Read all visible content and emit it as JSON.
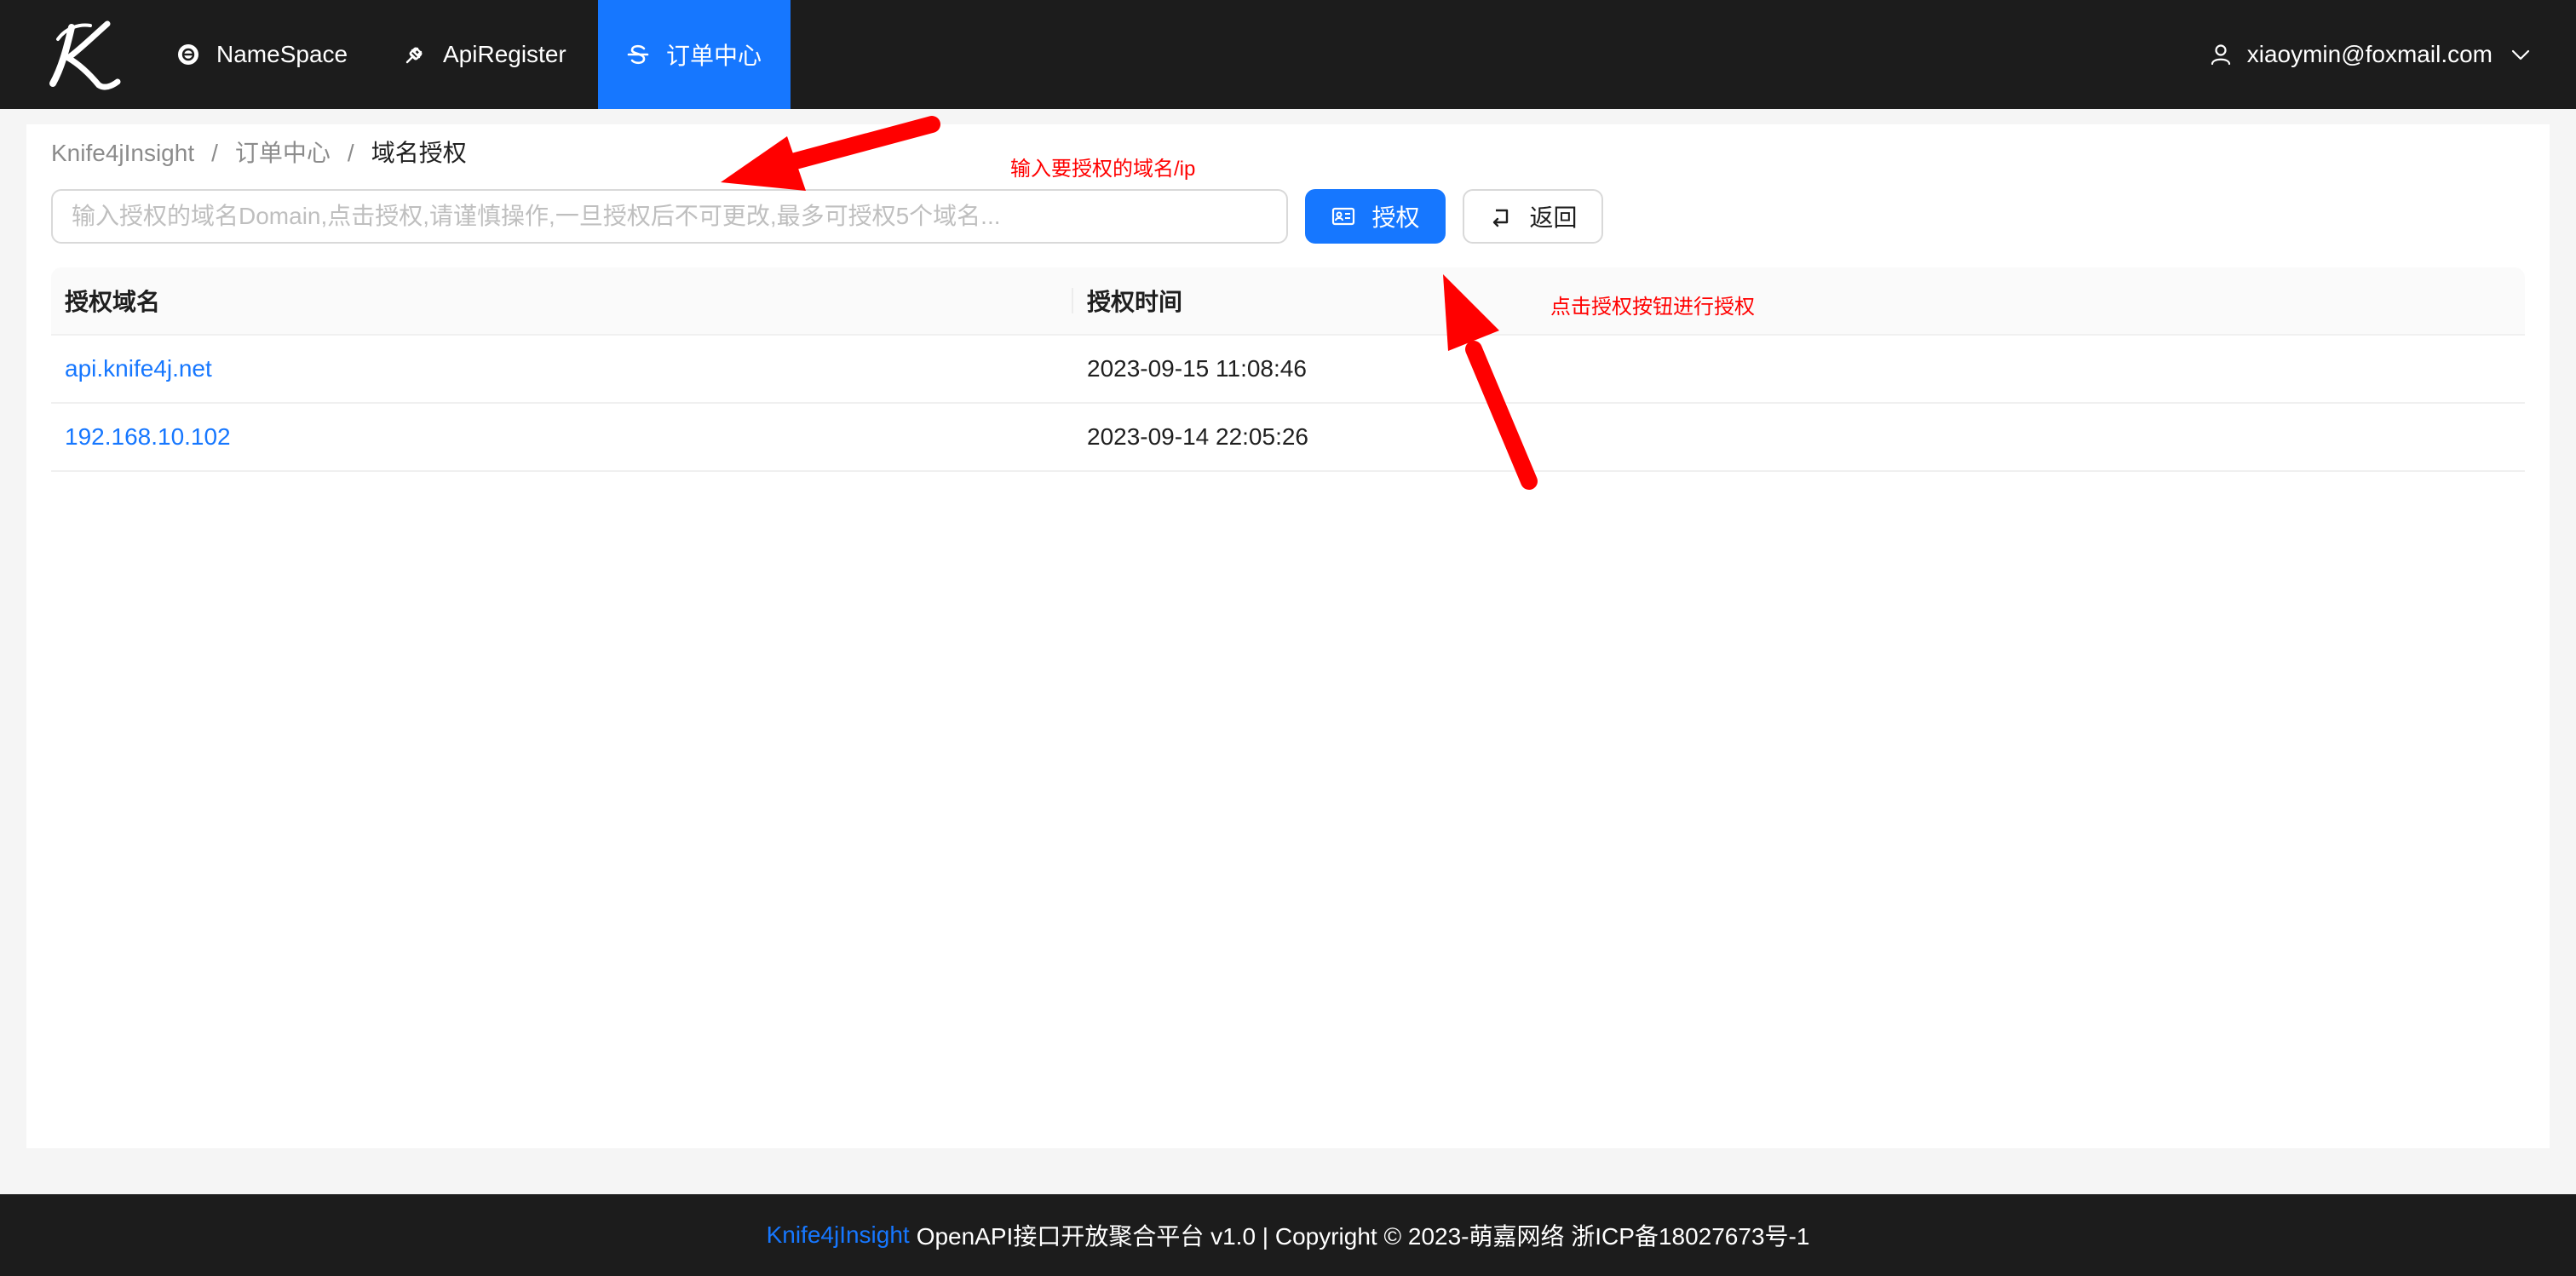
{
  "header": {
    "logo_letter": "K",
    "nav": [
      {
        "label": "NameSpace",
        "icon": "namespace-icon"
      },
      {
        "label": "ApiRegister",
        "icon": "api-register-icon"
      },
      {
        "label": "订单中心",
        "icon": "order-center-icon",
        "active": true
      }
    ],
    "user": {
      "email": "xiaoymin@foxmail.com",
      "icon": "user-icon",
      "chevron": "chevron-down-icon"
    }
  },
  "breadcrumb": {
    "items": [
      "Knife4jInsight",
      "订单中心",
      "域名授权"
    ],
    "separator": "/"
  },
  "form": {
    "input_placeholder": "输入授权的域名Domain,点击授权,请谨慎操作,一旦授权后不可更改,最多可授权5个域名...",
    "input_value": "",
    "authorize_label": "授权",
    "back_label": "返回"
  },
  "table": {
    "columns": [
      "授权域名",
      "授权时间"
    ],
    "rows": [
      {
        "domain": "api.knife4j.net",
        "time": "2023-09-15 11:08:46"
      },
      {
        "domain": "192.168.10.102",
        "time": "2023-09-14 22:05:26"
      }
    ]
  },
  "annotations": {
    "input_hint": "输入要授权的域名/ip",
    "button_hint": "点击授权按钮进行授权",
    "arrow_color": "#ff0000"
  },
  "footer": {
    "brand": "Knife4jInsight",
    "text": "OpenAPI接口开放聚合平台 v1.0 | Copyright © 2023-萌嘉网络 浙ICP备18027673号-1"
  },
  "colors": {
    "primary": "#1677ff",
    "header_bg": "#1c1c1c",
    "annotation": "#ff0000"
  }
}
